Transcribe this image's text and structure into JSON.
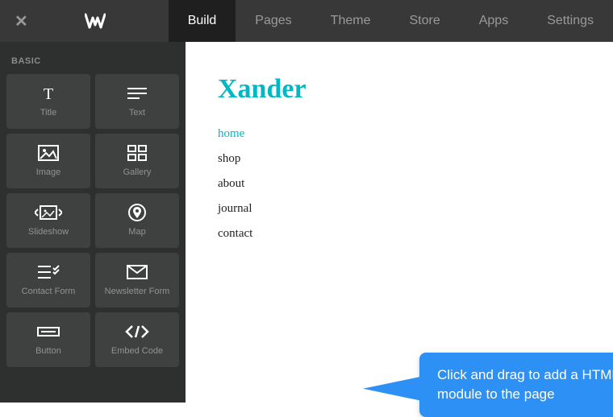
{
  "topbar": {
    "tabs": [
      {
        "label": "Build",
        "active": true
      },
      {
        "label": "Pages",
        "active": false
      },
      {
        "label": "Theme",
        "active": false
      },
      {
        "label": "Store",
        "active": false
      },
      {
        "label": "Apps",
        "active": false
      },
      {
        "label": "Settings",
        "active": false
      }
    ]
  },
  "sidebar": {
    "section_label": "BASIC",
    "tiles": [
      {
        "label": "Title",
        "icon": "title"
      },
      {
        "label": "Text",
        "icon": "text"
      },
      {
        "label": "Image",
        "icon": "image"
      },
      {
        "label": "Gallery",
        "icon": "gallery"
      },
      {
        "label": "Slideshow",
        "icon": "slideshow"
      },
      {
        "label": "Map",
        "icon": "map"
      },
      {
        "label": "Contact Form",
        "icon": "contact-form"
      },
      {
        "label": "Newsletter Form",
        "icon": "newsletter"
      },
      {
        "label": "Button",
        "icon": "button"
      },
      {
        "label": "Embed Code",
        "icon": "embed-code"
      }
    ]
  },
  "canvas": {
    "site_title": "Xander",
    "nav": [
      {
        "label": "home",
        "current": true
      },
      {
        "label": "shop",
        "current": false
      },
      {
        "label": "about",
        "current": false
      },
      {
        "label": "journal",
        "current": false
      },
      {
        "label": "contact",
        "current": false
      }
    ]
  },
  "callout": {
    "text": "Click and drag to add a HTML module to the page"
  }
}
